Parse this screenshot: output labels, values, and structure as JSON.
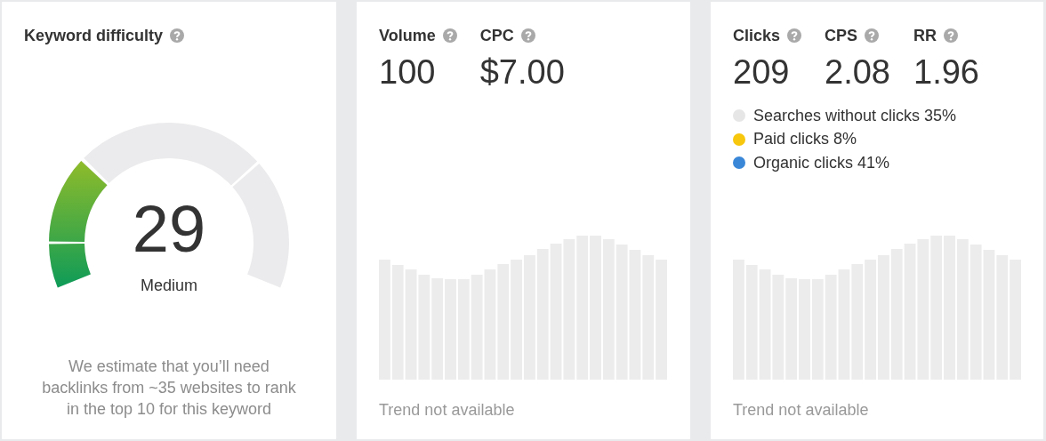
{
  "keyword_difficulty": {
    "title": "Keyword difficulty",
    "score": "29",
    "rating": "Medium",
    "description": "We estimate that you’ll need\nbacklinks from ~35 websites to rank\nin the top 10 for this keyword"
  },
  "volume_card": {
    "metrics": [
      {
        "label": "Volume",
        "value": "100"
      },
      {
        "label": "CPC",
        "value": "$7.00"
      }
    ],
    "trend_note": "Trend not available"
  },
  "clicks_card": {
    "metrics": [
      {
        "label": "Clicks",
        "value": "209"
      },
      {
        "label": "CPS",
        "value": "2.08"
      },
      {
        "label": "RR",
        "value": "1.96"
      }
    ],
    "legend": [
      {
        "label": "Searches without clicks 35%",
        "color": "#e6e6e6"
      },
      {
        "label": "Paid clicks 8%",
        "color": "#f7c70d"
      },
      {
        "label": "Organic clicks 41%",
        "color": "#3a87d8"
      }
    ],
    "trend_note": "Trend not available"
  }
}
